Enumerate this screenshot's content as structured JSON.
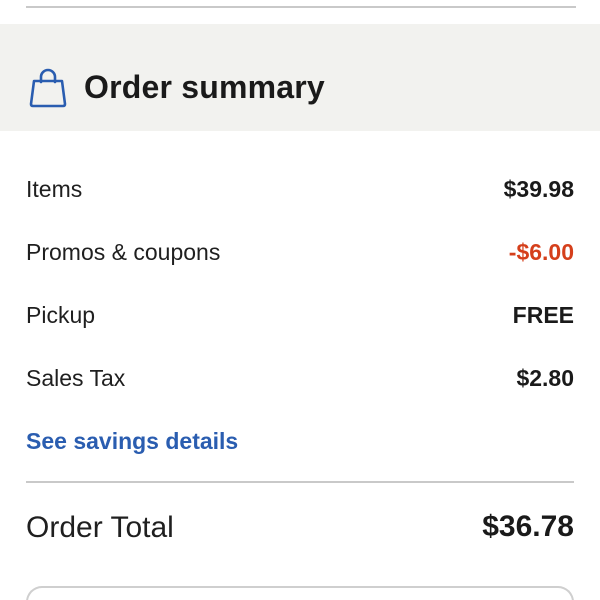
{
  "order_summary": {
    "title": "Order summary",
    "header_icon": "shopping-bag-icon",
    "lines": [
      {
        "label": "Items",
        "value": "$39.98"
      },
      {
        "label": "Promos & coupons",
        "value": "-$6.00"
      },
      {
        "label": "Pickup",
        "value": "FREE"
      },
      {
        "label": "Sales Tax",
        "value": "$2.80"
      }
    ],
    "savings_link": "See savings details",
    "total_label": "Order Total",
    "total_value": "$36.78"
  },
  "colors": {
    "header_background": "#f2f2ef",
    "discount": "#d53f1b",
    "link": "#2a5db0",
    "icon": "#2a5db0"
  }
}
